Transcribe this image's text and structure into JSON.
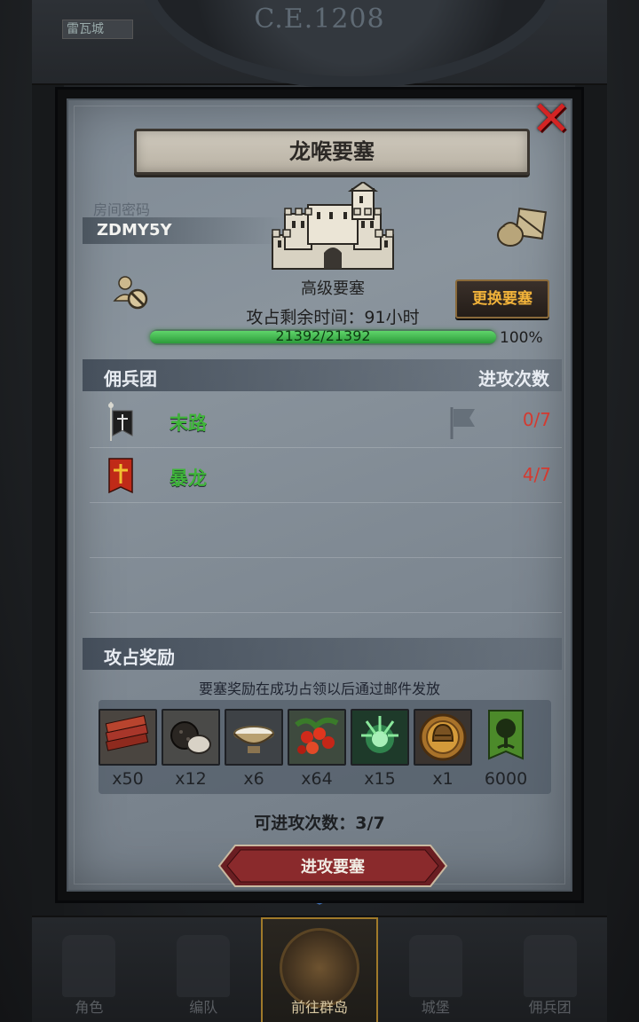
{
  "background": {
    "era_label": "C.E.1208",
    "top_tab_label": "雷瓦城",
    "nav": [
      {
        "label": "角色",
        "icon": "knight-icon"
      },
      {
        "label": "编队",
        "icon": "formation-icon"
      },
      {
        "label": "前往群岛",
        "icon": "compass-icon",
        "active": true
      },
      {
        "label": "城堡",
        "icon": "castle-icon"
      },
      {
        "label": "佣兵团",
        "icon": "mercenary-icon"
      }
    ]
  },
  "modal": {
    "title": "龙喉要塞",
    "close_icon": "close-x-icon",
    "room_label": "房间密码",
    "room_code": "ZDMY5Y",
    "fortress_level": "高级要塞",
    "time_left": "攻占剩余时间：91小时",
    "change_button": "更换要塞",
    "hp": {
      "current": 21392,
      "max": 21392,
      "text": "21392/21392",
      "percent": "100%",
      "fraction": 1.0
    },
    "mercenary_section": {
      "left_label": "佣兵团",
      "right_label": "进攻次数",
      "rows": [
        {
          "name": "末路",
          "count": "0/7",
          "banner_color": "#1e1e1e",
          "has_flag": true
        },
        {
          "name": "暴龙",
          "count": "4/7",
          "banner_color": "#c02a18",
          "has_flag": false
        }
      ]
    },
    "reward_section": {
      "title": "攻占奖励",
      "note": "要塞奖励在成功占领以后通过邮件发放",
      "items": [
        {
          "qty": "x50",
          "icon": "wood-planks-icon"
        },
        {
          "qty": "x12",
          "icon": "truffle-icon"
        },
        {
          "qty": "x6",
          "icon": "milk-bowl-icon"
        },
        {
          "qty": "x64",
          "icon": "berries-icon"
        },
        {
          "qty": "x15",
          "icon": "nature-rune-icon"
        },
        {
          "qty": "x1",
          "icon": "helmet-medal-icon"
        },
        {
          "qty": "6000",
          "icon": "tree-banner-icon"
        }
      ]
    },
    "attacks_available": "可进攻次数：3/7",
    "attack_button": "进攻要塞"
  },
  "colors": {
    "accent_green": "#3fb43a",
    "count_red": "#d43a30",
    "change_button_text": "#f2b33a",
    "close_red": "#d42424"
  }
}
